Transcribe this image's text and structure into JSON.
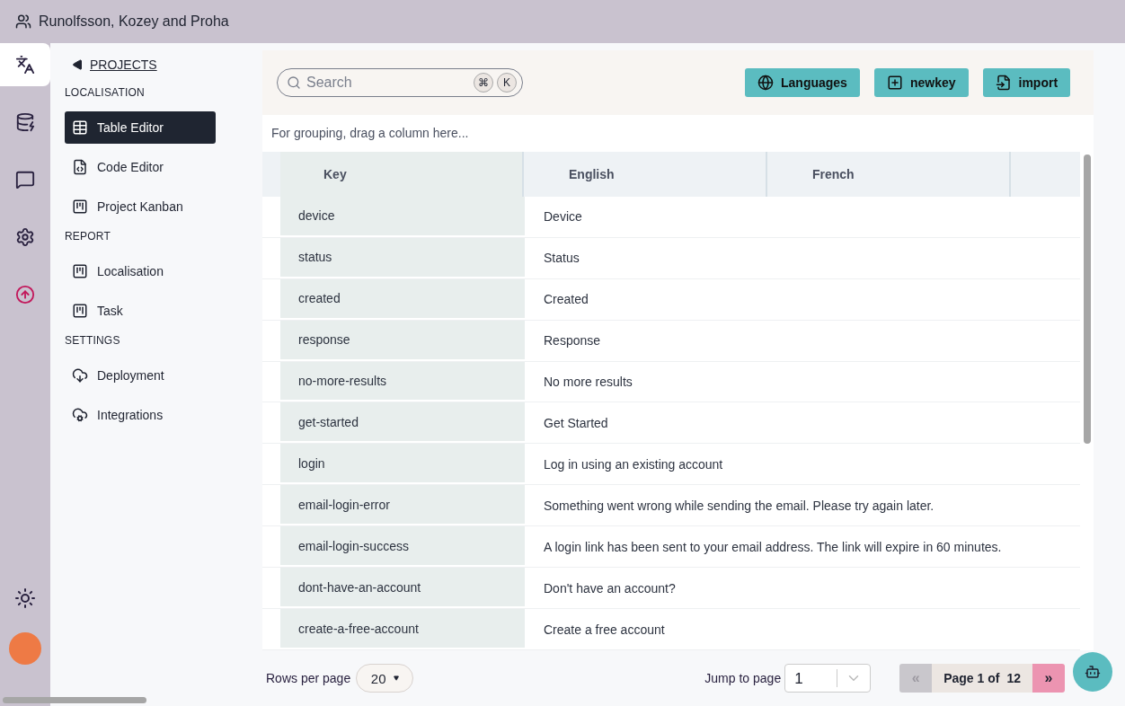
{
  "header": {
    "title": "Runolfsson, Kozey and Proha"
  },
  "rail": {
    "items": [
      {
        "kind": "translate",
        "selected": true
      },
      {
        "kind": "database",
        "selected": false
      },
      {
        "kind": "chat",
        "selected": false
      },
      {
        "kind": "settings",
        "selected": false
      },
      {
        "kind": "upload",
        "selected": false
      }
    ]
  },
  "sidebar": {
    "back": "PROJECTS",
    "sections": [
      {
        "title": "LOCALISATION",
        "items": [
          {
            "label": "Table Editor",
            "kind": "table",
            "selected": true
          },
          {
            "label": "Code Editor",
            "kind": "code",
            "selected": false
          },
          {
            "label": "Project Kanban",
            "kind": "kanban",
            "selected": false
          }
        ]
      },
      {
        "title": "REPORT",
        "items": [
          {
            "label": "Localisation",
            "kind": "kanban",
            "selected": false
          },
          {
            "label": "Task",
            "kind": "kanban",
            "selected": false
          }
        ]
      },
      {
        "title": "SETTINGS",
        "items": [
          {
            "label": "Deployment",
            "kind": "cloud-download",
            "selected": false
          },
          {
            "label": "Integrations",
            "kind": "cloud-gear",
            "selected": false
          }
        ]
      }
    ]
  },
  "toolbar": {
    "search": {
      "placeholder": "Search",
      "shortcut": [
        "⌘",
        "K"
      ]
    },
    "buttons": [
      {
        "label": "Languages",
        "kind": "globe"
      },
      {
        "label": "newkey",
        "kind": "plus"
      },
      {
        "label": "import",
        "kind": "import"
      }
    ]
  },
  "table": {
    "grouping_hint": "For grouping, drag a column here...",
    "columns": [
      "Key",
      "English",
      "French"
    ],
    "rows": [
      {
        "key": "device",
        "english": "Device"
      },
      {
        "key": "status",
        "english": "Status"
      },
      {
        "key": "created",
        "english": "Created"
      },
      {
        "key": "response",
        "english": "Response"
      },
      {
        "key": "no-more-results",
        "english": "No more results"
      },
      {
        "key": "get-started",
        "english": "Get Started"
      },
      {
        "key": "login",
        "english": "Log in using an existing account"
      },
      {
        "key": "email-login-error",
        "english": "Something went wrong while sending the email. Please try again later."
      },
      {
        "key": "email-login-success",
        "english": "A login link has been sent to your email address. The link will expire in 60 minutes."
      },
      {
        "key": "dont-have-an-account",
        "english": "Don't have an account?"
      },
      {
        "key": "create-a-free-account",
        "english": "Create a free account"
      }
    ]
  },
  "footer": {
    "rows_per_page_label": "Rows per page",
    "rows_per_page": "20",
    "jump_label": "Jump to page",
    "jump_value": "1",
    "page_label": "Page 1 of",
    "page_total": "12",
    "prev": {
      "label": "«",
      "disabled": true
    },
    "next": {
      "label": "»",
      "disabled": false
    }
  }
}
